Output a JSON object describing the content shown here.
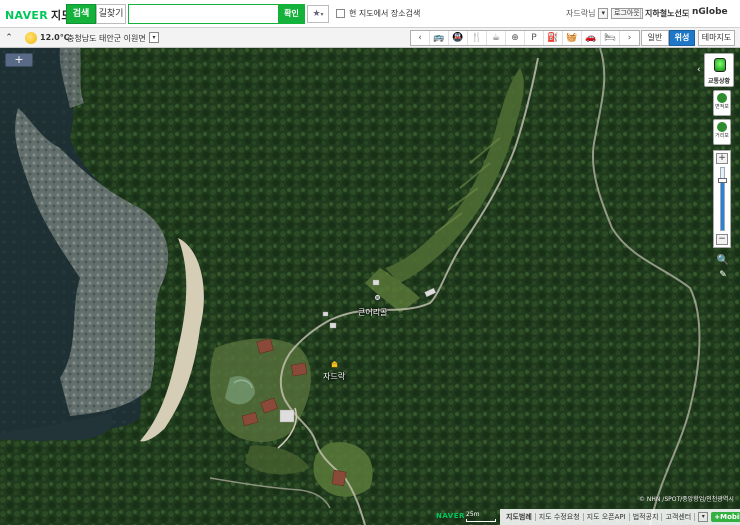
{
  "app": {
    "logo": "NAVER",
    "service": "지도"
  },
  "topbar": {
    "tab_search": "검색",
    "tab_directions": "길찾기",
    "search_value": "",
    "search_button": "확인",
    "favorite": "★",
    "local_search_label": "현 지도에서 장소검색",
    "user_name": "자드락님",
    "logout": "로그아웃",
    "subway": "지하철노선도",
    "nglobe": "nGlobe"
  },
  "toolbar2": {
    "collapse": "≈",
    "temperature": "12.0℃",
    "location": "충청남도 태안군 이원면",
    "location_dropdown": "▾",
    "poi_items": [
      {
        "name": "bus-icon",
        "glyph": "🚌"
      },
      {
        "name": "subway-icon",
        "glyph": "🚇"
      },
      {
        "name": "restaurant-icon",
        "glyph": "🍴"
      },
      {
        "name": "cafe-icon",
        "glyph": "☕"
      },
      {
        "name": "hospital-icon",
        "glyph": "⊕"
      },
      {
        "name": "parking-icon",
        "glyph": "P"
      },
      {
        "name": "gas-station-icon",
        "glyph": "⛽"
      },
      {
        "name": "shopping-icon",
        "glyph": "🧺"
      },
      {
        "name": "car-icon",
        "glyph": "🚗"
      },
      {
        "name": "hotel-icon",
        "glyph": "🛏"
      }
    ],
    "poi_prev": "‹",
    "poi_next": "›",
    "mode_normal": "일반",
    "mode_satellite": "위성",
    "mode_theme": "테마지도"
  },
  "map": {
    "expand": "+",
    "labels": {
      "village": "큰어리골",
      "poi": "자드락"
    },
    "traffic": "교통상황",
    "panel_toggle": "‹",
    "area_tool": "면적보",
    "distance_tool": "거리보",
    "zoom_in": "+",
    "zoom_out": "−",
    "zoom_level": 0.8,
    "magnifier": "🔍",
    "eraser": "✎",
    "copyright": "© NHN /SPOT/중앙항업/인천광역시"
  },
  "footer": {
    "naver_mark": "NAVER",
    "scale": "25m",
    "links": [
      "지도범례",
      "지도 수정요청",
      "지도 오픈API",
      "법적공지",
      "고객센터"
    ],
    "dropdown": "▾",
    "mobile": "+Mobile"
  },
  "colors": {
    "naver_green": "#03c75a",
    "search_green": "#14b13b",
    "satellite_blue": "#1f77c8"
  }
}
